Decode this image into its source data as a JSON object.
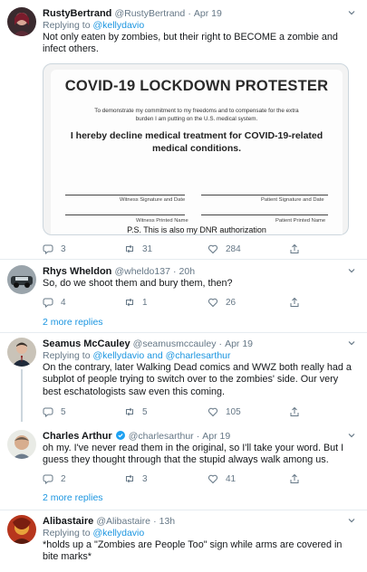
{
  "tweets": [
    {
      "name": "RustyBertrand",
      "handle": "@RustyBertrand",
      "dot": "·",
      "time": "Apr 19",
      "replying_prefix": "Replying to",
      "replying_to": "@kellydavio",
      "text": "Not only eaten by zombies, but their right to BECOME a zombie and infect others.",
      "replies": "3",
      "retweets": "31",
      "likes": "284"
    },
    {
      "name": "Rhys Wheldon",
      "handle": "@wheldo137",
      "dot": "·",
      "time": "20h",
      "text": "So, do we shoot them and bury them, then?",
      "replies": "4",
      "retweets": "1",
      "likes": "26",
      "more_replies": "2 more replies"
    },
    {
      "name": "Seamus McCauley",
      "handle": "@seamusmccauley",
      "dot": "·",
      "time": "Apr 19",
      "replying_prefix": "Replying to",
      "replying_to": "@kellydavio and @charlesarthur",
      "text": "On the contrary, later Walking Dead comics and WWZ both really had a subplot of people trying to switch over to the zombies' side. Our very best eschatologists saw even this coming.",
      "replies": "5",
      "retweets": "5",
      "likes": "105"
    },
    {
      "name": "Charles Arthur",
      "handle": "@charlesarthur",
      "dot": "·",
      "time": "Apr 19",
      "text": "oh my. I've never read them in the original, so I'll take your word. But I guess they thought through that the stupid always walk among us.",
      "replies": "2",
      "retweets": "3",
      "likes": "41",
      "more_replies": "2 more replies"
    },
    {
      "name": "Alibastaire",
      "handle": "@Alibastaire",
      "dot": "·",
      "time": "13h",
      "replying_prefix": "Replying to",
      "replying_to": "@kellydavio",
      "text": "*holds up a \"Zombies are People Too\" sign while arms are covered in bite marks*"
    }
  ],
  "document": {
    "title": "COVID-19 LOCKDOWN PROTESTER",
    "subtitle": "To demonstrate my commitment to my freedoms and to compensate for the extra burden I am putting on the U.S. medical system.",
    "declaration": "I hereby decline medical treatment for COVID-19-related medical conditions.",
    "witness_sig": "Witness Signature and Date",
    "patient_sig": "Patient Signature and Date",
    "witness_name": "Witness Printed Name",
    "patient_name": "Patient Printed Name",
    "ps": "P.S. This is also my DNR authorization"
  },
  "colors": {
    "link": "#1b95e0",
    "muted": "#657786",
    "divider": "#e6ecf0",
    "verified": "#1da1f2"
  }
}
